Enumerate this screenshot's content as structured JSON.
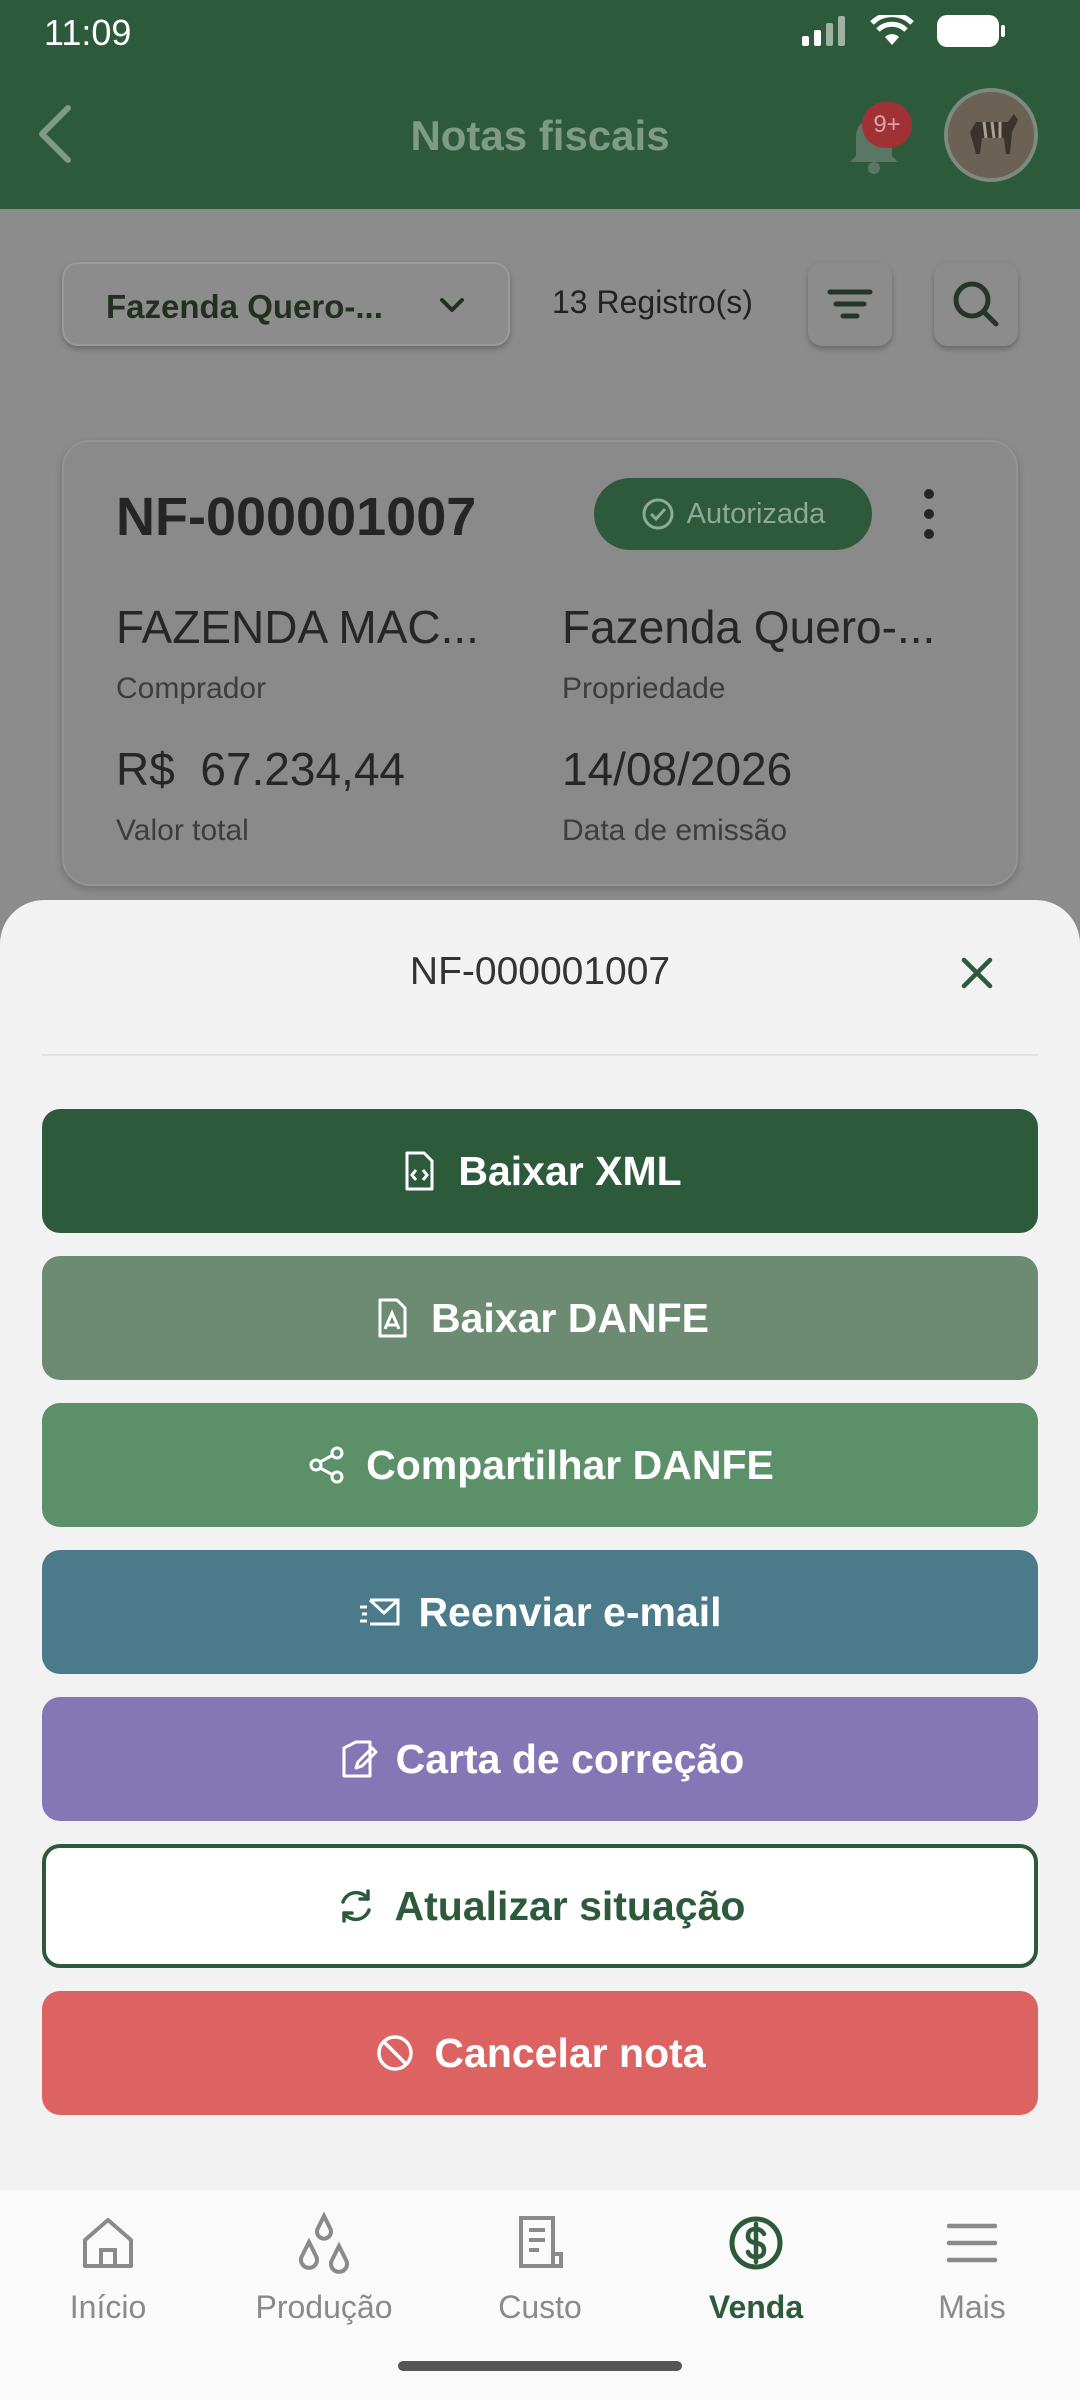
{
  "status_bar": {
    "time": "11:09"
  },
  "header": {
    "title": "Notas fiscais",
    "notification_badge": "9+"
  },
  "filters": {
    "farm": "Fazenda Quero-...",
    "records": "13 Registro(s)"
  },
  "card": {
    "number": "NF-000001007",
    "status": "Autorizada",
    "buyer": "FAZENDA MAC...",
    "buyer_label": "Comprador",
    "property": "Fazenda Quero-...",
    "property_label": "Propriedade",
    "total": "R$  67.234,44",
    "total_label": "Valor total",
    "date": "14/08/2026",
    "date_label": "Data de emissão"
  },
  "sheet": {
    "title": "NF-000001007",
    "actions": [
      {
        "label": "Baixar XML",
        "icon": "file-code-icon",
        "color": "#2e5a3c"
      },
      {
        "label": "Baixar DANFE",
        "icon": "file-pdf-icon",
        "color": "#6d8b72"
      },
      {
        "label": "Compartilhar DANFE",
        "icon": "share-icon",
        "color": "#5b9068"
      },
      {
        "label": "Reenviar e-mail",
        "icon": "mail-send-icon",
        "color": "#4b7a8a"
      },
      {
        "label": "Carta de correção",
        "icon": "edit-document-icon",
        "color": "#8477b6"
      },
      {
        "label": "Atualizar situação",
        "icon": "refresh-icon",
        "color": "#2e5a3c"
      },
      {
        "label": "Cancelar nota",
        "icon": "cancel-icon",
        "color": "#dc6362"
      }
    ]
  },
  "nav": [
    {
      "label": "Início",
      "icon": "home-icon",
      "active": false
    },
    {
      "label": "Produção",
      "icon": "drops-icon",
      "active": false
    },
    {
      "label": "Custo",
      "icon": "receipt-icon",
      "active": false
    },
    {
      "label": "Venda",
      "icon": "dollar-circle-icon",
      "active": true
    },
    {
      "label": "Mais",
      "icon": "menu-icon",
      "active": false
    }
  ]
}
